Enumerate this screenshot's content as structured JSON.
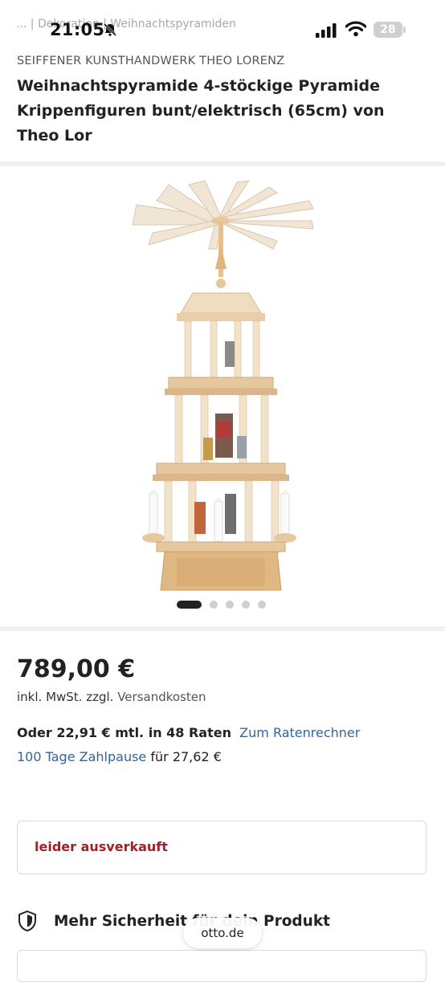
{
  "status": {
    "time": "21:05",
    "battery": "28",
    "breadcrumb": "... | Dekoration | Weihnachtspyramiden"
  },
  "product": {
    "brand": "SEIFFENER KUNSTHANDWERK THEO LORENZ",
    "title": "Weihnachtspyramide 4-stöckige Pyramide Krippenfiguren bunt/elektrisch (65cm) von Theo Lor"
  },
  "gallery": {
    "image_icon": "christmas-pyramid-image",
    "active_index": 1,
    "total": 5
  },
  "pricing": {
    "price": "789,00 €",
    "tax_text": "inkl. MwSt. zzgl.",
    "shipping_link": "Versandkosten",
    "installment_text": "Oder 22,91 € mtl. in 48 Raten",
    "installment_link": "Zum Ratenrechner",
    "pause_link": "100 Tage Zahlpause",
    "pause_text": "für 27,62 €"
  },
  "availability": {
    "label": "leider ausverkauft",
    "color": "#a3202b"
  },
  "security": {
    "label": "Mehr Sicherheit für dein Produkt",
    "icon": "shield-icon"
  },
  "browser": {
    "url": "otto.de"
  },
  "colors": {
    "link": "#2f64a8",
    "text": "#222222",
    "separator": "#f0f0f0"
  }
}
